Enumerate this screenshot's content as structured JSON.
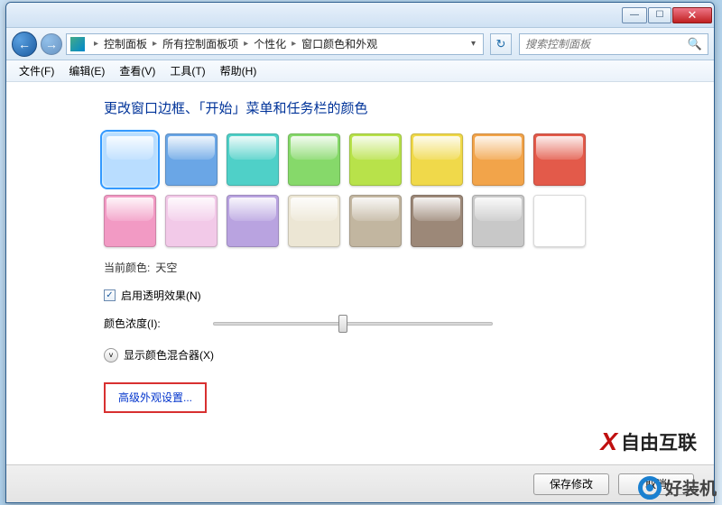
{
  "titlebar": {
    "min": "—",
    "max": "☐",
    "close": "✕"
  },
  "nav": {
    "back": "←",
    "fwd": "→",
    "refresh": "↻"
  },
  "breadcrumb": [
    "控制面板",
    "所有控制面板项",
    "个性化",
    "窗口颜色和外观"
  ],
  "search": {
    "placeholder": "搜索控制面板",
    "icon": "🔍"
  },
  "menu": [
    "文件(F)",
    "编辑(E)",
    "查看(V)",
    "工具(T)",
    "帮助(H)"
  ],
  "heading": "更改窗口边框、「开始」菜单和任务栏的颜色",
  "colors": {
    "row1": [
      "#b9ddff",
      "#6aa6e6",
      "#4fd0c8",
      "#86d96a",
      "#b8e24a",
      "#f0d94a",
      "#f2a44a",
      "#e35a4a"
    ],
    "row2": [
      "#f29ac4",
      "#f2c9e8",
      "#b9a3e0",
      "#ece6d4",
      "#c2b6a0",
      "#9c8878",
      "#c8c8c8",
      "#ffffff"
    ],
    "selected_index": 0
  },
  "current_color": {
    "label": "当前颜色:",
    "value": "天空"
  },
  "transparency": {
    "checked": "✓",
    "label": "启用透明效果(N)"
  },
  "intensity": {
    "label": "颜色浓度(I):"
  },
  "mixer": {
    "chev": "˅",
    "label": "显示颜色混合器(X)"
  },
  "advanced_link": "高级外观设置...",
  "footer": {
    "save": "保存修改",
    "cancel": "取消"
  },
  "watermark1": "自由互联",
  "watermark2": "好装机"
}
